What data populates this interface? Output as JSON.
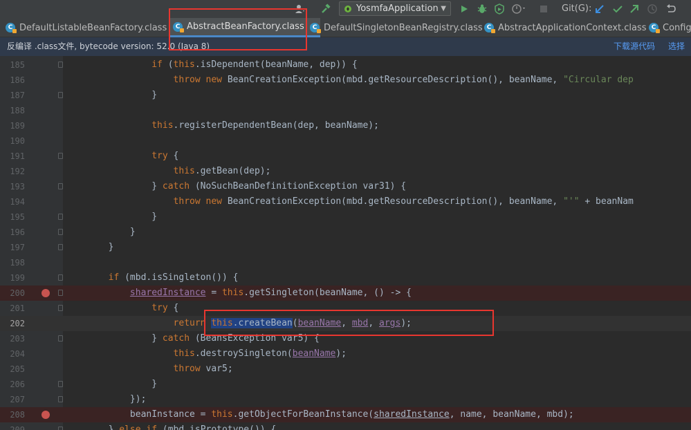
{
  "toolbar": {
    "run_config": "YosmfaApplication",
    "git_label": "Git(G):",
    "icons": [
      "build-icon",
      "run-icon",
      "debug-icon",
      "coverage-icon",
      "profile-icon",
      "stop-icon",
      "git-update-icon",
      "git-commit-icon",
      "git-push-icon",
      "history-icon",
      "rollback-icon"
    ]
  },
  "tabs": [
    {
      "label": "DefaultListableBeanFactory.class",
      "close": "×",
      "active": false
    },
    {
      "label": "AbstractBeanFactory.class",
      "close": "×",
      "active": true
    },
    {
      "label": "DefaultSingletonBeanRegistry.class",
      "close": "×",
      "active": false
    },
    {
      "label": "AbstractApplicationContext.class",
      "close": "×",
      "active": false
    },
    {
      "label": "Configu",
      "close": "",
      "active": false
    }
  ],
  "banner": {
    "message": "反编译 .class文件, bytecode version: 52.0 (Java 8)",
    "download_link": "下载源代码",
    "choose_link": "选择源"
  },
  "editor": {
    "lines": [
      {
        "n": "185",
        "text": "                if (this.isDependent(beanName, dep)) {"
      },
      {
        "n": "186",
        "text": "                    throw new BeanCreationException(mbd.getResourceDescription(), beanName, \"Circular dep"
      },
      {
        "n": "187",
        "text": "                }"
      },
      {
        "n": "188",
        "text": ""
      },
      {
        "n": "189",
        "text": "                this.registerDependentBean(dep, beanName);"
      },
      {
        "n": "190",
        "text": ""
      },
      {
        "n": "191",
        "text": "                try {"
      },
      {
        "n": "192",
        "text": "                    this.getBean(dep);"
      },
      {
        "n": "193",
        "text": "                } catch (NoSuchBeanDefinitionException var31) {"
      },
      {
        "n": "194",
        "text": "                    throw new BeanCreationException(mbd.getResourceDescription(), beanName, \"'\" + beanNam"
      },
      {
        "n": "195",
        "text": "                }"
      },
      {
        "n": "196",
        "text": "            }"
      },
      {
        "n": "197",
        "text": "        }"
      },
      {
        "n": "198",
        "text": ""
      },
      {
        "n": "199",
        "text": "        if (mbd.isSingleton()) {"
      },
      {
        "n": "200",
        "text": "            sharedInstance = this.getSingleton(beanName, () -> {"
      },
      {
        "n": "201",
        "text": "                try {"
      },
      {
        "n": "202",
        "text": "                    return this.createBean(beanName, mbd, args);"
      },
      {
        "n": "203",
        "text": "                } catch (BeansException var5) {"
      },
      {
        "n": "204",
        "text": "                    this.destroySingleton(beanName);"
      },
      {
        "n": "205",
        "text": "                    throw var5;"
      },
      {
        "n": "206",
        "text": "                }"
      },
      {
        "n": "207",
        "text": "            });"
      },
      {
        "n": "208",
        "text": "            beanInstance = this.getObjectForBeanInstance(sharedInstance, name, beanName, mbd);"
      },
      {
        "n": "209",
        "text": "        } else if (mbd.isPrototype()) {"
      }
    ]
  },
  "colors": {
    "keyword": "#cc7832",
    "string": "#6a8759",
    "field": "#9876aa",
    "default_text": "#a9b7c6",
    "breakpoint": "#c75450",
    "annotation_box": "#e8362f",
    "selection": "#214283"
  }
}
